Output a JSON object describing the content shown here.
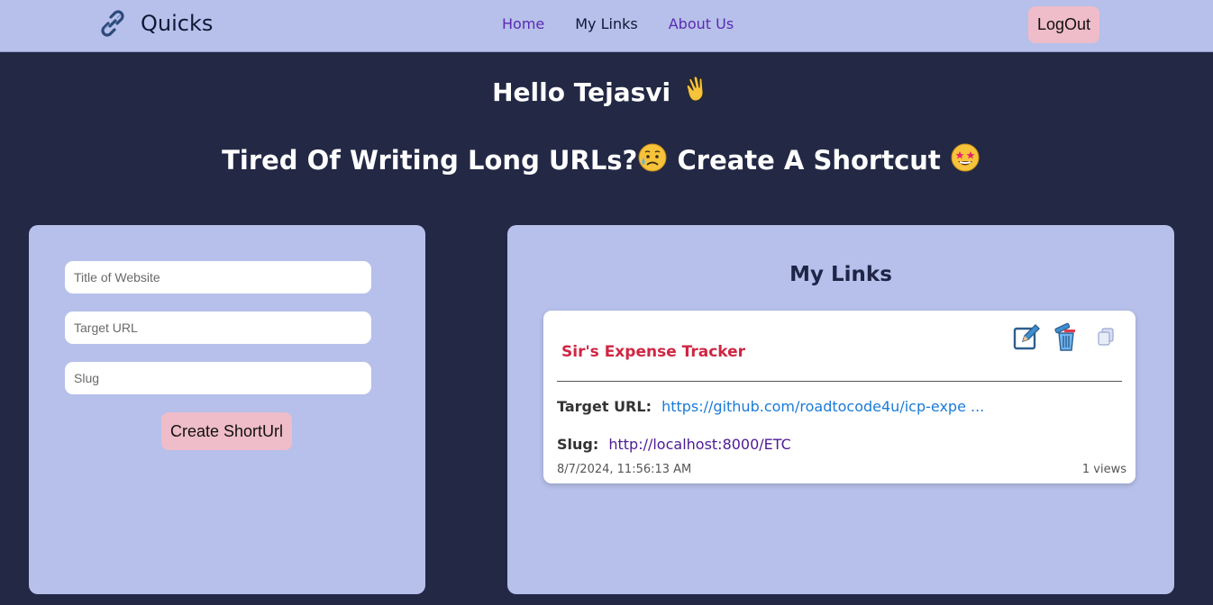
{
  "navbar": {
    "brand_icon": "link-icon",
    "brand_name": "Quicks",
    "links": {
      "home": "Home",
      "my_links": "My Links",
      "about_us": "About Us"
    },
    "logout_label": "LogOut",
    "bg_color": "#b6c0ea"
  },
  "hero": {
    "greeting": "Hello Tejasvi",
    "greeting_emoji": "waving-hand-icon",
    "tagline_part1": "Tired Of Writing Long URLs?",
    "tagline_emoji1": "sad-sweat-face-icon",
    "tagline_part2": "Create A Shortcut",
    "tagline_emoji2": "star-struck-face-icon"
  },
  "form": {
    "title_placeholder": "Title of Website",
    "target_placeholder": "Target URL",
    "slug_placeholder": "Slug",
    "create_label": "Create ShortUrl"
  },
  "links": {
    "heading": "My Links",
    "items": [
      {
        "title": "Sir's Expense Tracker",
        "target_label": "Target URL:",
        "target_url": "https://github.com/roadtocode4u/icp-expe ...",
        "slug_label": "Slug:",
        "slug_url": "http://localhost:8000/ETC",
        "created": "8/7/2024, 11:56:13 AM",
        "views": "1 views",
        "actions": [
          "edit-icon",
          "delete-icon",
          "copy-icon"
        ]
      }
    ]
  },
  "colors": {
    "background": "#232845",
    "panel": "#b6c0ea",
    "button": "#efbcc9",
    "title_red": "#cf2643",
    "link_blue": "#1a7bd8",
    "slug_purple": "#4c1a94"
  }
}
